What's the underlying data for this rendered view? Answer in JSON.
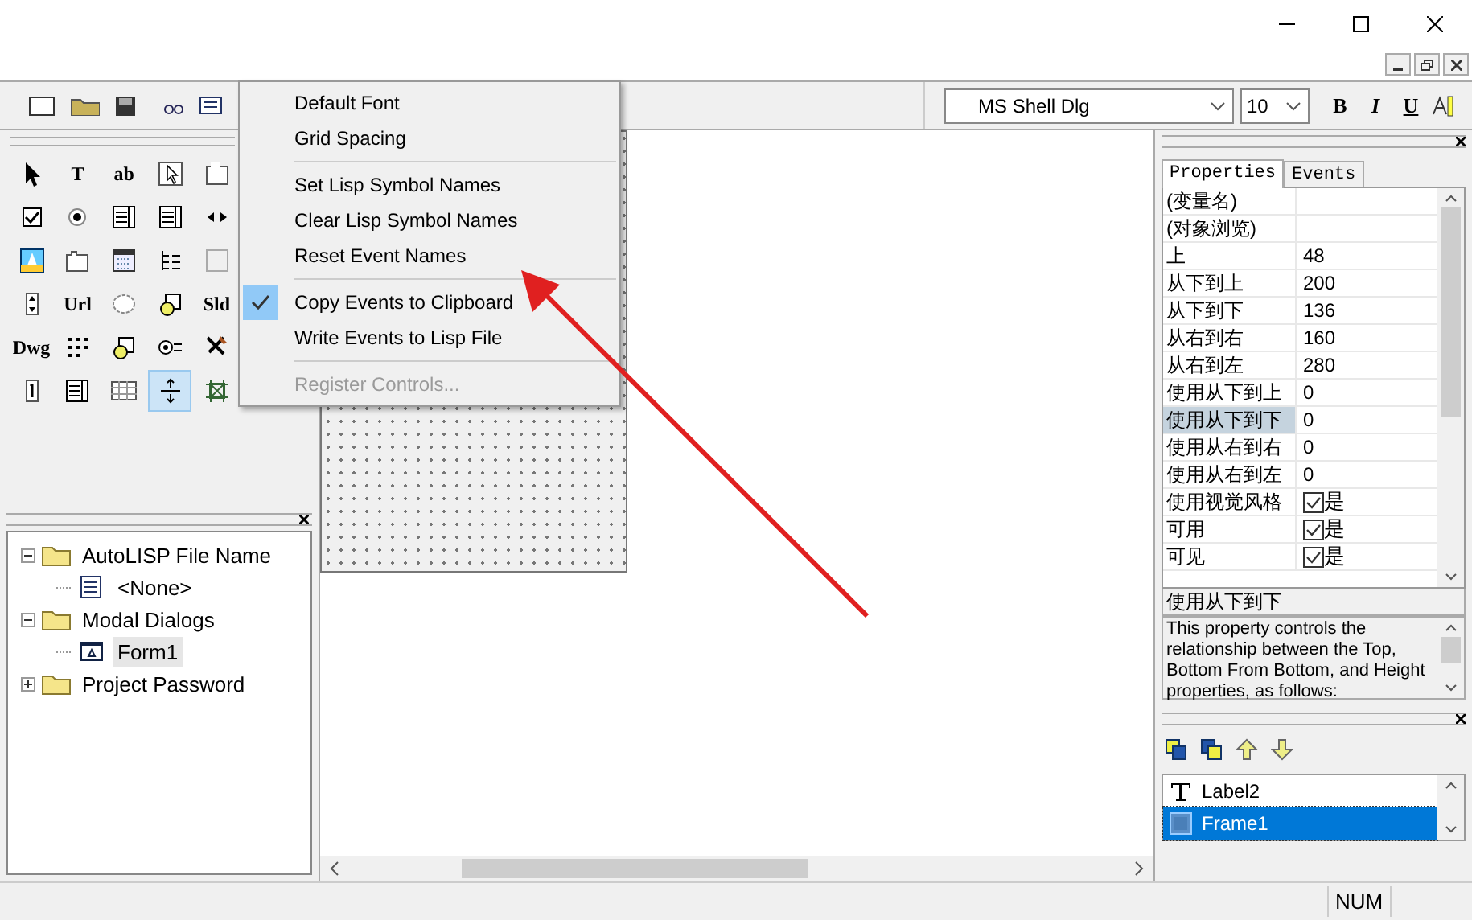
{
  "font_toolbar": {
    "font_name": "MS Shell Dlg",
    "font_size": "10",
    "buttons": [
      {
        "label": "B",
        "kind": "bold"
      },
      {
        "label": "I",
        "kind": "italic"
      },
      {
        "label": "U",
        "kind": "underline"
      }
    ]
  },
  "toolbox": [
    {
      "kind": "pointer",
      "selected": false
    },
    {
      "kind": "text",
      "label": "T",
      "selected": false
    },
    {
      "kind": "text",
      "label": "ab",
      "selected": false
    },
    {
      "kind": "cursor",
      "selected": false
    },
    {
      "kind": "frame",
      "selected": false
    },
    {
      "kind": "checkbox",
      "selected": false
    },
    {
      "kind": "radio",
      "selected": false
    },
    {
      "kind": "list",
      "selected": false
    },
    {
      "kind": "list",
      "selected": false
    },
    {
      "kind": "arrows",
      "selected": false
    },
    {
      "kind": "image",
      "selected": false
    },
    {
      "kind": "tab",
      "selected": false
    },
    {
      "kind": "calendar",
      "selected": false
    },
    {
      "kind": "tree",
      "selected": false
    },
    {
      "kind": "blank",
      "selected": false
    },
    {
      "kind": "spin",
      "selected": false
    },
    {
      "kind": "text",
      "label": "Url",
      "selected": false
    },
    {
      "kind": "ellipse",
      "selected": false
    },
    {
      "kind": "shapes",
      "selected": false
    },
    {
      "kind": "text",
      "label": "Sld",
      "selected": false
    },
    {
      "kind": "text",
      "label": "Dwg",
      "selected": false
    },
    {
      "kind": "dots",
      "selected": false
    },
    {
      "kind": "shapes",
      "selected": false
    },
    {
      "kind": "option",
      "selected": false
    },
    {
      "kind": "tools",
      "selected": false
    },
    {
      "kind": "counter",
      "selected": false
    },
    {
      "kind": "list",
      "selected": false
    },
    {
      "kind": "grid",
      "selected": false
    },
    {
      "kind": "splitter",
      "selected": true
    },
    {
      "kind": "crop",
      "selected": false
    }
  ],
  "menu": [
    [
      {
        "label": "Default Font",
        "checked": false,
        "disabled": false
      },
      {
        "label": "Grid Spacing",
        "checked": false,
        "disabled": false
      }
    ],
    [
      {
        "label": "Set Lisp Symbol Names",
        "checked": false,
        "disabled": false
      },
      {
        "label": "Clear Lisp Symbol Names",
        "checked": false,
        "disabled": false
      },
      {
        "label": "Reset Event Names",
        "checked": false,
        "disabled": false
      }
    ],
    [
      {
        "label": "Copy Events to Clipboard",
        "checked": true,
        "disabled": false
      },
      {
        "label": "Write Events to Lisp File",
        "checked": false,
        "disabled": false
      }
    ],
    [
      {
        "label": "Register Controls...",
        "checked": false,
        "disabled": true
      }
    ]
  ],
  "project_tree": [
    {
      "label": "AutoLISP File Name",
      "kind": "folder",
      "expanded": true,
      "selected": false,
      "children": [
        {
          "label": "<None>",
          "kind": "lisp",
          "selected": false
        }
      ]
    },
    {
      "label": "Modal Dialogs",
      "kind": "folder",
      "expanded": true,
      "selected": false,
      "children": [
        {
          "label": "Form1",
          "kind": "form",
          "selected": true
        }
      ]
    },
    {
      "label": "Project Password",
      "kind": "folder",
      "expanded": false,
      "selected": false
    }
  ],
  "properties": {
    "tabs": [
      {
        "label": "Properties",
        "selected": true
      },
      {
        "label": "Events",
        "selected": false
      }
    ],
    "rows": [
      {
        "name": "(变量名)",
        "value": "",
        "kind": "text",
        "selected": false
      },
      {
        "name": "(对象浏览)",
        "value": "",
        "kind": "text",
        "selected": false
      },
      {
        "name": "上",
        "value": "48",
        "kind": "text",
        "selected": false
      },
      {
        "name": "从下到上",
        "value": "200",
        "kind": "text",
        "selected": false
      },
      {
        "name": "从下到下",
        "value": "136",
        "kind": "text",
        "selected": false
      },
      {
        "name": "从右到右",
        "value": "160",
        "kind": "text",
        "selected": false
      },
      {
        "name": "从右到左",
        "value": "280",
        "kind": "text",
        "selected": false
      },
      {
        "name": "使用从下到上",
        "value": "0",
        "kind": "text",
        "selected": false
      },
      {
        "name": "使用从下到下",
        "value": "0",
        "kind": "text",
        "selected": true
      },
      {
        "name": "使用从右到右",
        "value": "0",
        "kind": "text",
        "selected": false
      },
      {
        "name": "使用从右到左",
        "value": "0",
        "kind": "text",
        "selected": false
      },
      {
        "name": "使用视觉风格",
        "value": "是",
        "kind": "check",
        "checked": true,
        "selected": false
      },
      {
        "name": "可用",
        "value": "是",
        "kind": "check",
        "checked": true,
        "selected": false
      },
      {
        "name": "可见",
        "value": "是",
        "kind": "check",
        "checked": true,
        "selected": false
      }
    ],
    "description_title": "使用从下到下",
    "description": "This property controls the relationship between the Top, Bottom From Bottom, and Height properties, as follows:"
  },
  "controls_list": [
    {
      "label": "Label2",
      "kind": "label",
      "selected": false
    },
    {
      "label": "Frame1",
      "kind": "frame",
      "selected": true
    }
  ],
  "status_bar": {
    "indicator": "NUM"
  }
}
